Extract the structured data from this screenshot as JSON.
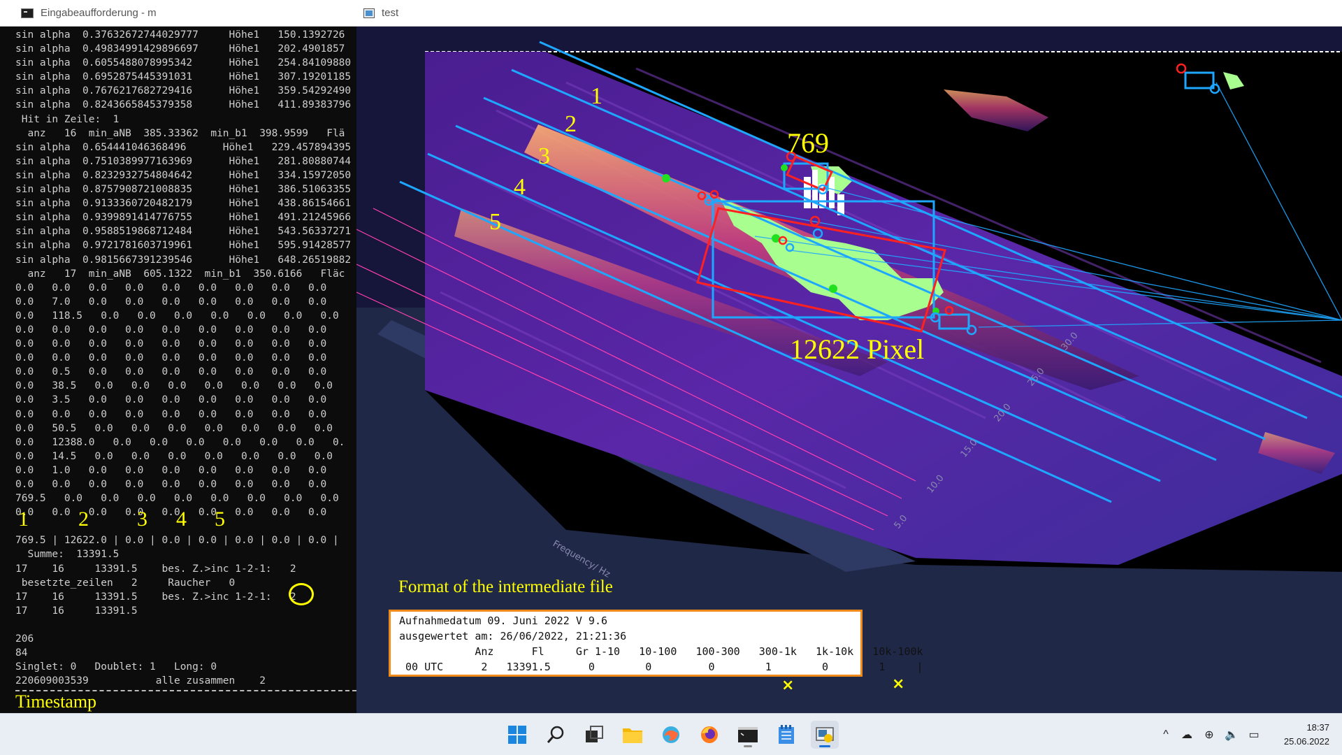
{
  "console": {
    "title": "Eingabeaufforderung - m",
    "lines": [
      "sin alpha  0.37632672744029777     Höhe1   150.1392726",
      "sin alpha  0.49834991429896697     Höhe1   202.4901857",
      "sin alpha  0.6055488078995342      Höhe1   254.84109880",
      "sin alpha  0.6952875445391031      Höhe1   307.19201185",
      "sin alpha  0.7676217682729416      Höhe1   359.54292490",
      "sin alpha  0.8243665845379358      Höhe1   411.89383796",
      " Hit in Zeile:  1",
      "  anz   16  min_aNB  385.33362  min_b1  398.9599   Flä",
      "sin alpha  0.654441046368496      Höhe1   229.457894395",
      "sin alpha  0.7510389977163969      Höhe1   281.80880744",
      "sin alpha  0.8232932754804642      Höhe1   334.15972050",
      "sin alpha  0.8757908721008835      Höhe1   386.51063355",
      "sin alpha  0.9133360720482179      Höhe1   438.86154661",
      "sin alpha  0.9399891414776755      Höhe1   491.21245966",
      "sin alpha  0.9588519868712484      Höhe1   543.56337271",
      "sin alpha  0.9721781603719961      Höhe1   595.91428577",
      "sin alpha  0.9815667391239546      Höhe1   648.26519882",
      "  anz   17  min_aNB  605.1322  min_b1  350.6166   Fläc",
      "0.0   0.0   0.0   0.0   0.0   0.0   0.0   0.0   0.0",
      "0.0   7.0   0.0   0.0   0.0   0.0   0.0   0.0   0.0",
      "0.0   118.5   0.0   0.0   0.0   0.0   0.0   0.0   0.0",
      "0.0   0.0   0.0   0.0   0.0   0.0   0.0   0.0   0.0",
      "0.0   0.0   0.0   0.0   0.0   0.0   0.0   0.0   0.0",
      "0.0   0.0   0.0   0.0   0.0   0.0   0.0   0.0   0.0",
      "0.0   0.5   0.0   0.0   0.0   0.0   0.0   0.0   0.0",
      "0.0   38.5   0.0   0.0   0.0   0.0   0.0   0.0   0.0",
      "0.0   3.5   0.0   0.0   0.0   0.0   0.0   0.0   0.0",
      "0.0   0.0   0.0   0.0   0.0   0.0   0.0   0.0   0.0",
      "0.0   50.5   0.0   0.0   0.0   0.0   0.0   0.0   0.0",
      "0.0   12388.0   0.0   0.0   0.0   0.0   0.0   0.0   0.",
      "0.0   14.5   0.0   0.0   0.0   0.0   0.0   0.0   0.0",
      "0.0   1.0   0.0   0.0   0.0   0.0   0.0   0.0   0.0",
      "0.0   0.0   0.0   0.0   0.0   0.0   0.0   0.0   0.0",
      "769.5   0.0   0.0   0.0   0.0   0.0   0.0   0.0   0.0",
      "0.0   0.0   0.0   0.0   0.0   0.0   0.0   0.0   0.0",
      "",
      "769.5 | 12622.0 | 0.0 | 0.0 | 0.0 | 0.0 | 0.0 | 0.0 |",
      "  Summe:  13391.5",
      "17    16     13391.5    bes. Z.>inc 1-2-1:   2",
      " besetzte_zeilen   2     Raucher   0",
      "17    16     13391.5    bes. Z.>inc 1-2-1:   2",
      "17    16     13391.5",
      "",
      "206",
      "84",
      "Singlet: 0   Doublet: 1   Long: 0",
      "220609003539           alle zusammen    2"
    ],
    "column_numbers": [
      "1",
      "2",
      "3",
      "4",
      "5"
    ],
    "timestamp_label": "Timestamp"
  },
  "plot_window": {
    "title": "test",
    "line_labels": [
      "1",
      "2",
      "3",
      "4",
      "5"
    ],
    "count_small": "769",
    "count_large": "12622 Pixel",
    "axis_label": "Frequency/ Hz",
    "axis_ticks": [
      "5.0",
      "10.0",
      "15.0",
      "20.0",
      "25.0",
      "30.0"
    ],
    "format_title": "Format of the intermediate file",
    "format_lines": [
      "Aufnahmedatum 09. Juni 2022 V 9.6",
      "ausgewertet am: 26/06/2022, 21:21:36",
      "            Anz      Fl     Gr 1-10   10-100   100-300   300-1k   1k-10k   10k-100k",
      " 00 UTC      2   13391.5      0        0         0        1        0        1     |"
    ],
    "marks": [
      "×",
      "×"
    ]
  },
  "colors": {
    "highlight_yellow": "#ffff00",
    "cyan_lines": "#1ea7ff",
    "red_boxes": "#ff2020",
    "detected_green": "#a8ff90",
    "format_border": "#f08b1a"
  },
  "taskbar": {
    "icons": [
      "windows-start-icon",
      "search-icon",
      "task-view-icon",
      "file-explorer-icon",
      "edge-icon",
      "firefox-icon",
      "terminal-icon",
      "notepad-icon",
      "python-app-icon"
    ],
    "time": "18:37",
    "date": "25.06.2022"
  }
}
